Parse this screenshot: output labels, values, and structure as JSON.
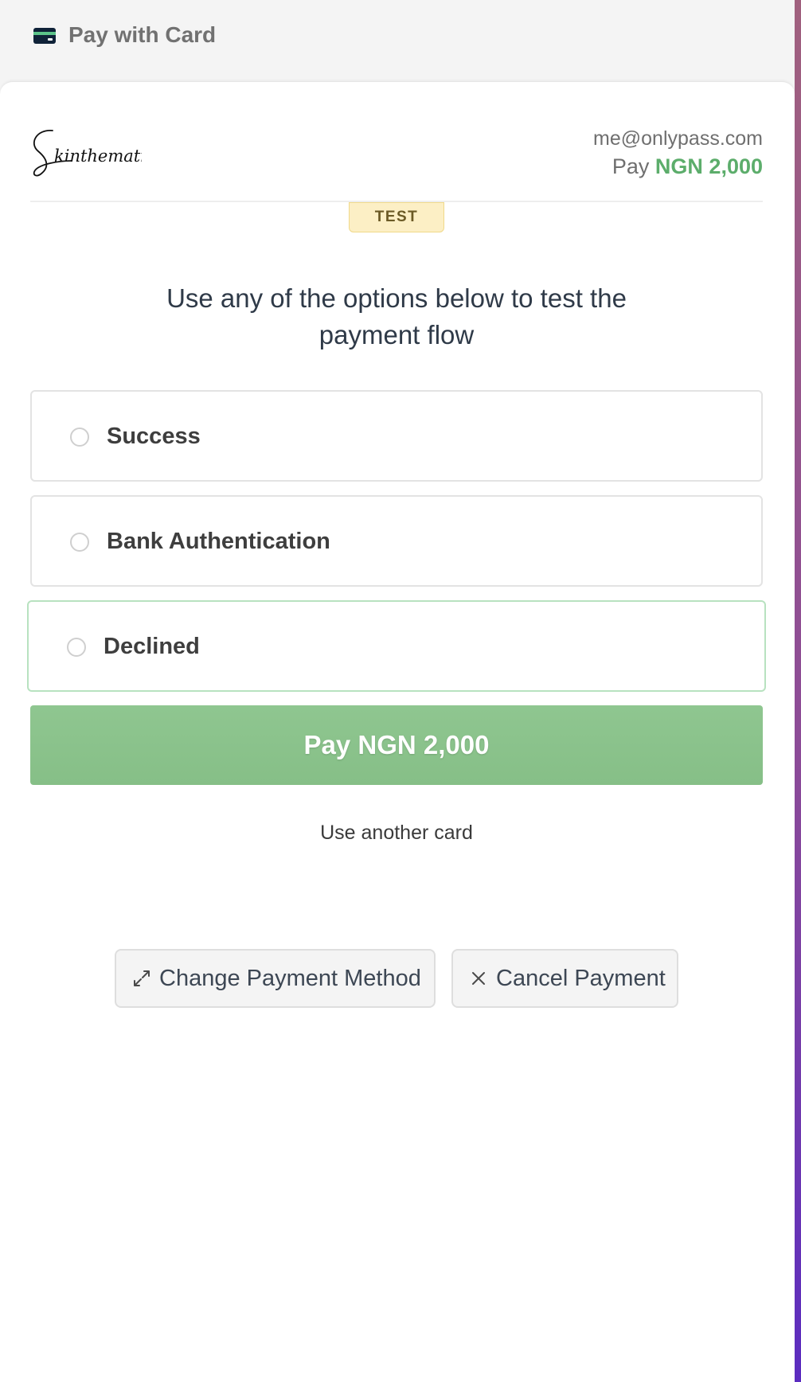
{
  "header": {
    "title": "Pay with Card",
    "icon": "credit-card-icon"
  },
  "merchant": {
    "logo_text": "Skinthematics"
  },
  "customer": {
    "email": "me@onlypass.com",
    "pay_prefix": "Pay",
    "amount": "NGN 2,000",
    "amount_color": "#5cad6b"
  },
  "badge": {
    "label": "TEST"
  },
  "instructions": "Use any of the options below to test the payment flow",
  "options": [
    {
      "label": "Success",
      "selected": false
    },
    {
      "label": "Bank Authentication",
      "selected": false
    },
    {
      "label": "Declined",
      "selected": true
    }
  ],
  "pay_button": {
    "label": "Pay NGN 2,000",
    "color": "#8cc48d"
  },
  "another_card": "Use another card",
  "footer": {
    "change_method": {
      "label": "Change Payment Method",
      "icon": "swap-arrows-icon"
    },
    "cancel": {
      "label": "Cancel Payment",
      "icon": "close-icon"
    }
  }
}
